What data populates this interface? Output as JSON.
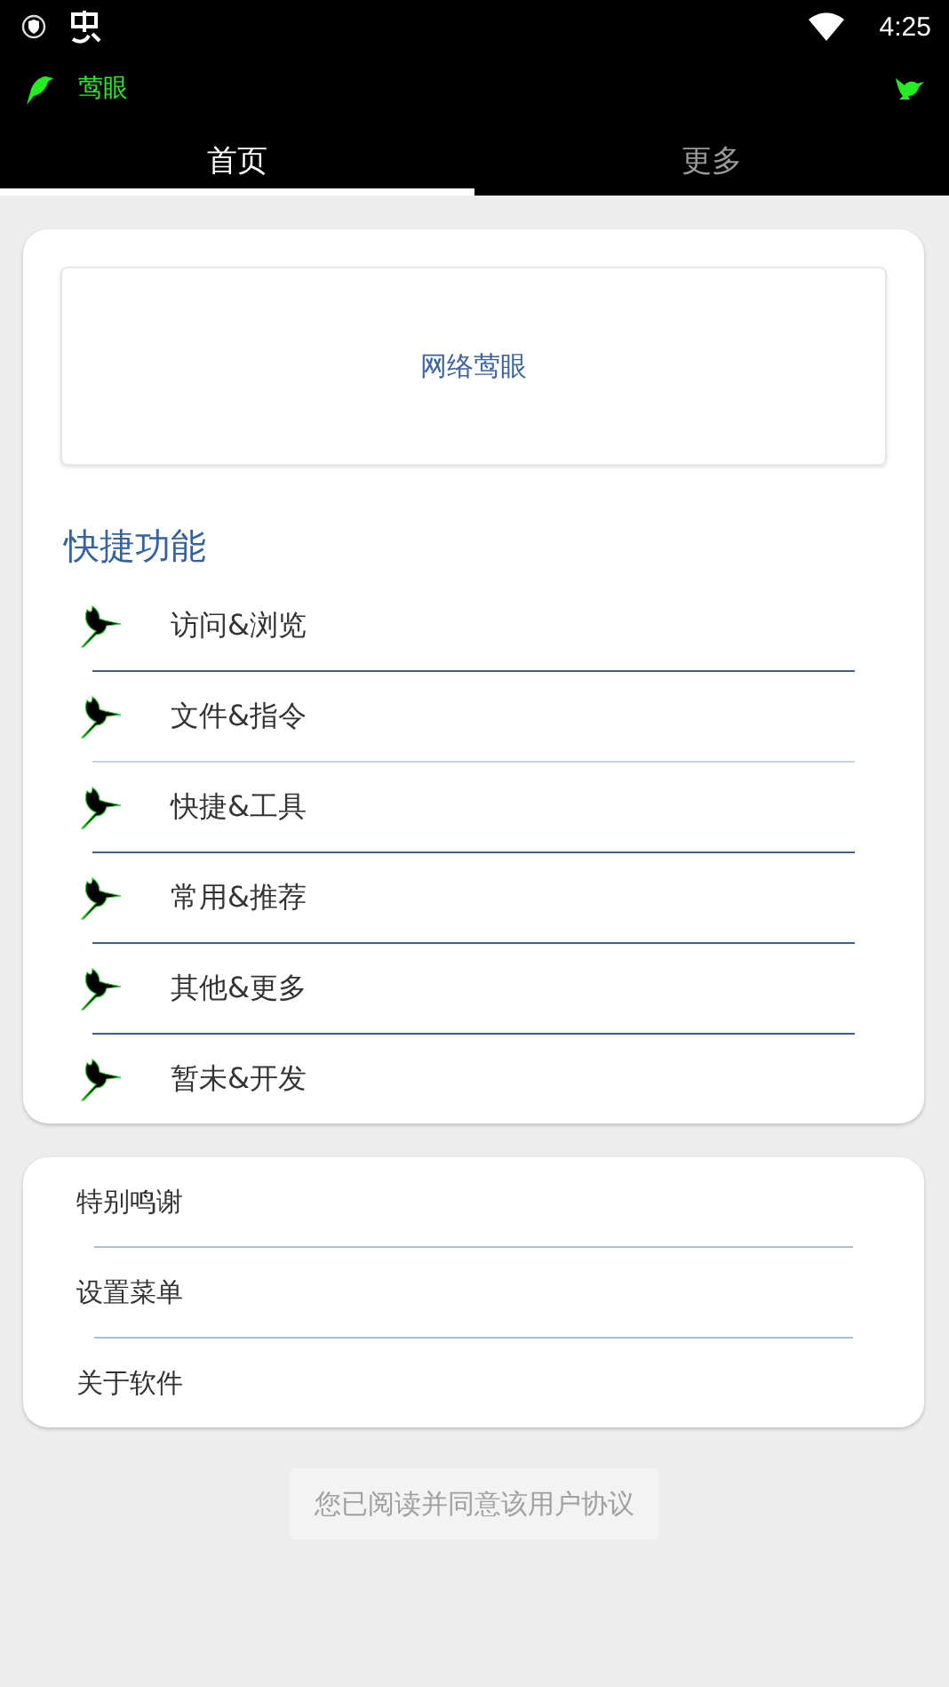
{
  "status_bar": {
    "time": "4:25"
  },
  "toolbar": {
    "title": "莺眼"
  },
  "tabs": [
    {
      "label": "首页",
      "selected": true
    },
    {
      "label": "更多",
      "selected": false
    }
  ],
  "banner": {
    "label": "网络莺眼"
  },
  "quick_functions": {
    "heading": "快捷功能",
    "items": [
      "访问&浏览",
      "文件&指令",
      "快捷&工具",
      "常用&推荐",
      "其他&更多",
      "暂未&开发"
    ]
  },
  "menu": [
    "特别鸣谢",
    "设置菜单",
    "关于软件"
  ],
  "agreement_button": {
    "label": "您已阅读并同意该用户协议",
    "disabled": true
  }
}
